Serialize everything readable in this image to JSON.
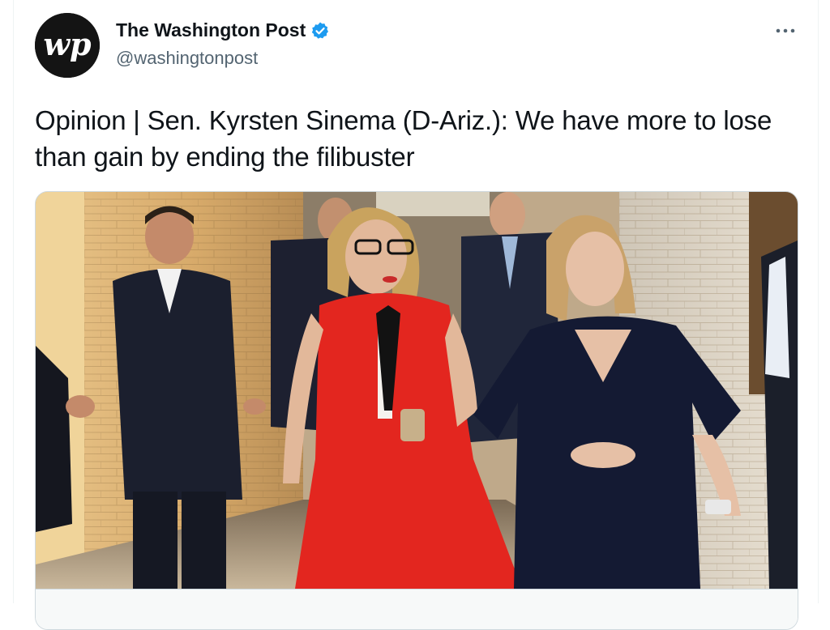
{
  "tweet": {
    "author": {
      "display_name": "The Washington Post",
      "handle": "@washingtonpost",
      "verified": true,
      "avatar_monogram": "wp"
    },
    "text": "Opinion | Sen. Kyrsten Sinema (D-Ariz.): We have more to lose than gain by ending the filibuster",
    "more_icon": "more-horizontal-icon",
    "verified_icon": "verified-badge-icon"
  },
  "colors": {
    "verified_blue": "#1d9bf0",
    "text_primary": "#0f1419",
    "text_secondary": "#536471",
    "border": "#cfd9de"
  }
}
